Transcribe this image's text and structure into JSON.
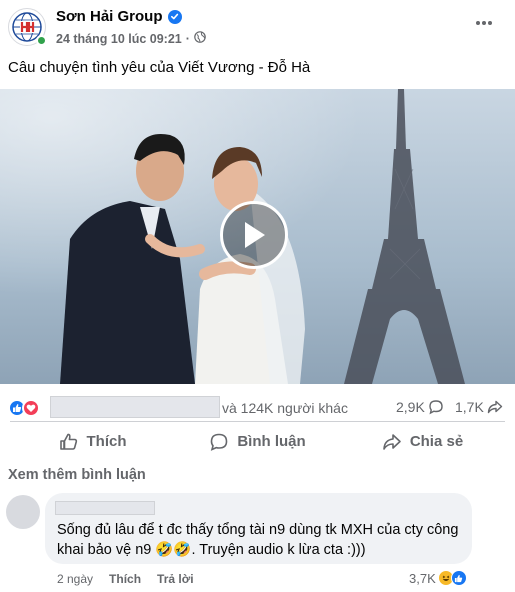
{
  "post": {
    "page_name": "Sơn Hải Group",
    "timestamp": "24 tháng 10 lúc 09:21",
    "separator": "·",
    "caption": "Câu chuyện tình yêu của Viết Vương - Đỗ Hà",
    "icons": {
      "verified": "verified-badge-icon",
      "audience": "globe-icon",
      "more": "more-options-icon",
      "play": "play-icon"
    }
  },
  "reactions": {
    "others_text": "và 124K người khác",
    "comments": "2,9K",
    "shares": "1,7K",
    "icons": [
      "like-icon",
      "love-icon"
    ]
  },
  "actions": {
    "like": "Thích",
    "comment": "Bình luận",
    "share": "Chia sẻ"
  },
  "comments": {
    "see_more": "Xem thêm bình luận",
    "items": [
      {
        "text": "Sống đủ lâu để t đc thấy tổng tài n9 dùng tk MXH của cty công khai bảo vệ n9 🤣🤣. Truyện audio k lừa cta :)))",
        "time": "2 ngày",
        "like_label": "Thích",
        "reply_label": "Trả lời",
        "reaction_count": "3,7K"
      }
    ]
  },
  "colors": {
    "brand_blue": "#1877f2",
    "love_red": "#f33e58",
    "secondary_text": "#65676b",
    "online_green": "#31a24c"
  }
}
